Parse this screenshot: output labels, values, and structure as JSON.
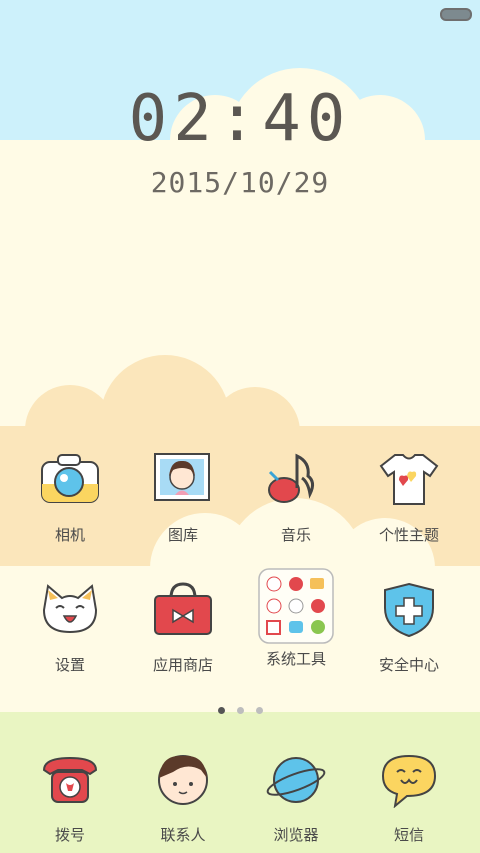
{
  "lockscreen": {
    "time": "02:40",
    "date": "2015/10/29"
  },
  "apps_row1": [
    {
      "label": "相机",
      "icon": "camera-icon"
    },
    {
      "label": "图库",
      "icon": "gallery-icon"
    },
    {
      "label": "音乐",
      "icon": "music-note-icon"
    },
    {
      "label": "个性主题",
      "icon": "tshirt-icon"
    }
  ],
  "apps_row2": [
    {
      "label": "设置",
      "icon": "cat-face-icon"
    },
    {
      "label": "应用商店",
      "icon": "shopping-bag-icon"
    },
    {
      "label": "系统工具",
      "icon": "folder-icon"
    },
    {
      "label": "安全中心",
      "icon": "shield-plus-icon"
    }
  ],
  "dock": [
    {
      "label": "拨号",
      "icon": "phone-icon"
    },
    {
      "label": "联系人",
      "icon": "contact-icon"
    },
    {
      "label": "浏览器",
      "icon": "planet-icon"
    },
    {
      "label": "短信",
      "icon": "speech-bubble-icon"
    }
  ],
  "pager": {
    "pages": 3,
    "active": 0
  },
  "colors": {
    "sky": "#cdf1fb",
    "cream": "#fffbe6",
    "peach": "#fbe6bb",
    "dock": "#e9f5c2"
  }
}
